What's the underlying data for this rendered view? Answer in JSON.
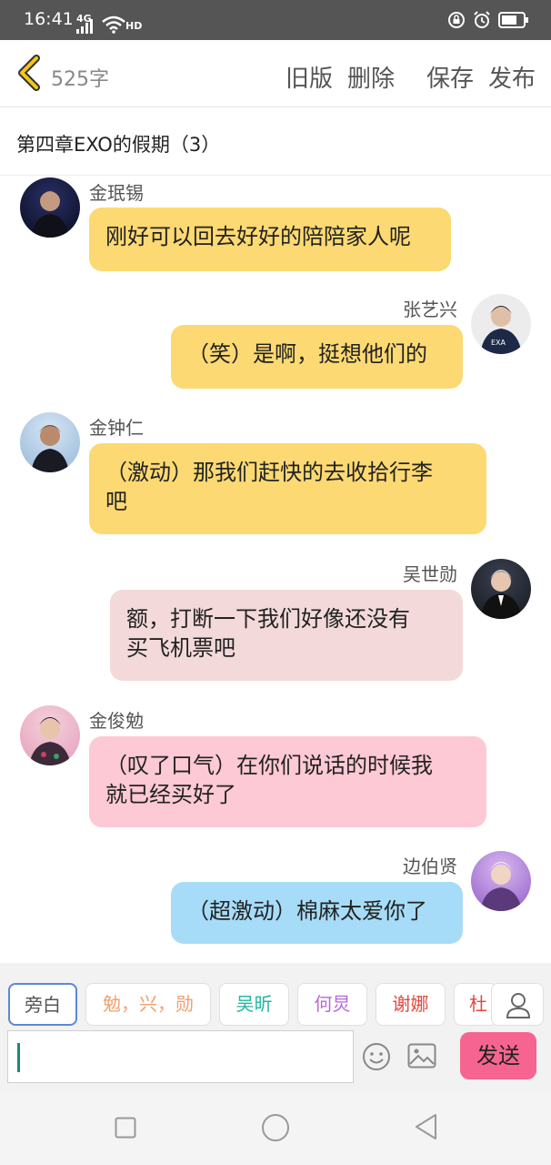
{
  "status_bar": {
    "time": "16:41",
    "network": "4G",
    "hd": "HD"
  },
  "header": {
    "word_count": "525字",
    "buttons": {
      "old_version": "旧版",
      "delete": "删除",
      "save": "保存",
      "publish": "发布"
    }
  },
  "chapter": {
    "title": "第四章EXO的假期（3）"
  },
  "messages": [
    {
      "side": "left",
      "name": "金珉锡",
      "text": "刚好可以回去好好的陪陪家人呢",
      "color": "#fcd972"
    },
    {
      "side": "right",
      "name": "张艺兴",
      "text": "（笑）是啊，挺想他们的",
      "color": "#fcd972"
    },
    {
      "side": "left",
      "name": "金钟仁",
      "line1": "（激动）那我们赶快的去收拾行李",
      "line2": "吧",
      "color": "#fcd972"
    },
    {
      "side": "right",
      "name": "吴世勋",
      "line1": "额，打断一下我们好像还没有",
      "line2": "买飞机票吧",
      "color": "#f3d9d9"
    },
    {
      "side": "left",
      "name": "金俊勉",
      "line1": "（叹了口气）在你们说话的时候我",
      "line2": "就已经买好了",
      "color": "#fcc9d4"
    },
    {
      "side": "right",
      "name": "边伯贤",
      "text": "（超激动）棉麻太爱你了",
      "color": "#a6dcf7"
    }
  ],
  "toolbar": {
    "chips": [
      {
        "label": "旁白",
        "color": "#555555"
      },
      {
        "label": "勉，兴，勋",
        "color": "#f0a070"
      },
      {
        "label": "吴昕",
        "color": "#23b5a5"
      },
      {
        "label": "何炅",
        "color": "#b36ad6"
      },
      {
        "label": "谢娜",
        "color": "#e0483f"
      },
      {
        "label": "杜",
        "color": "#e0483f"
      }
    ],
    "input_placeholder": "",
    "send_label": "发送"
  },
  "icons": {
    "back": "chevron-left-icon",
    "emoji": "smiley-icon",
    "image": "image-icon",
    "person": "person-icon"
  }
}
